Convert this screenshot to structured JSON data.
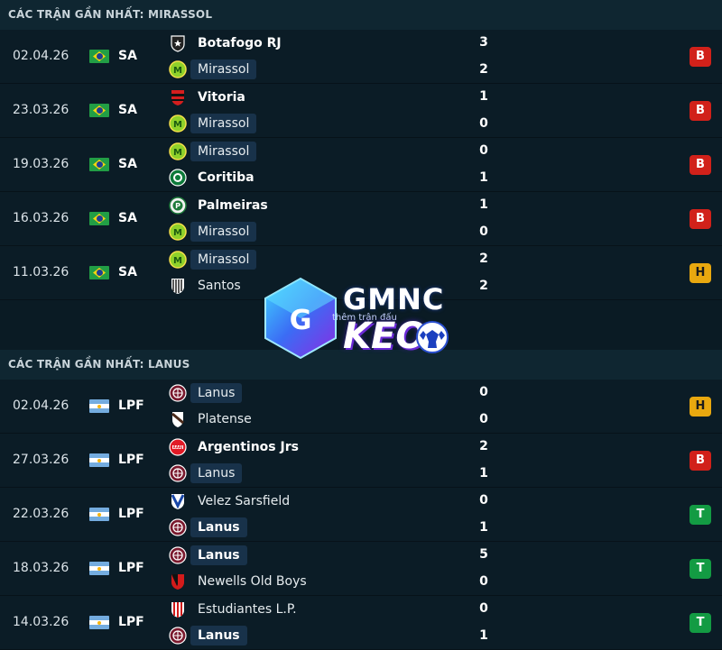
{
  "sections": [
    {
      "title": "CÁC TRẬN GẦN NHẤT: MIRASSOL",
      "matches": [
        {
          "date": "02.04.26",
          "flag": "brazil",
          "league": "SA",
          "home": "Botafogo RJ",
          "away": "Mirassol",
          "home_score": "3",
          "away_score": "2",
          "result": "B"
        },
        {
          "date": "23.03.26",
          "flag": "brazil",
          "league": "SA",
          "home": "Vitoria",
          "away": "Mirassol",
          "home_score": "1",
          "away_score": "0",
          "result": "B"
        },
        {
          "date": "19.03.26",
          "flag": "brazil",
          "league": "SA",
          "home": "Mirassol",
          "away": "Coritiba",
          "home_score": "0",
          "away_score": "1",
          "result": "B"
        },
        {
          "date": "16.03.26",
          "flag": "brazil",
          "league": "SA",
          "home": "Palmeiras",
          "away": "Mirassol",
          "home_score": "1",
          "away_score": "0",
          "result": "B"
        },
        {
          "date": "11.03.26",
          "flag": "brazil",
          "league": "SA",
          "home": "Mirassol",
          "away": "Santos",
          "home_score": "2",
          "away_score": "2",
          "result": "H"
        }
      ]
    },
    {
      "title": "CÁC TRẬN GẦN NHẤT: LANUS",
      "matches": [
        {
          "date": "02.04.26",
          "flag": "argentina",
          "league": "LPF",
          "home": "Lanus",
          "away": "Platense",
          "home_score": "0",
          "away_score": "0",
          "result": "H"
        },
        {
          "date": "27.03.26",
          "flag": "argentina",
          "league": "LPF",
          "home": "Argentinos Jrs",
          "away": "Lanus",
          "home_score": "2",
          "away_score": "1",
          "result": "B"
        },
        {
          "date": "22.03.26",
          "flag": "argentina",
          "league": "LPF",
          "home": "Velez Sarsfield",
          "away": "Lanus",
          "home_score": "0",
          "away_score": "1",
          "result": "T"
        },
        {
          "date": "18.03.26",
          "flag": "argentina",
          "league": "LPF",
          "home": "Lanus",
          "away": "Newells Old Boys",
          "home_score": "5",
          "away_score": "0",
          "result": "T"
        },
        {
          "date": "14.03.26",
          "flag": "argentina",
          "league": "LPF",
          "home": "Estudiantes L.P.",
          "away": "Lanus",
          "home_score": "0",
          "away_score": "1",
          "result": "T"
        }
      ]
    }
  ],
  "watermark": {
    "line1": "GMNC",
    "line2": "KEO",
    "tagline": "thêm trận đấu"
  },
  "colors": {
    "loss": "#d1211a",
    "draw": "#e9a80f",
    "win": "#139b43",
    "highlight": "#18324a"
  },
  "crest_icons": {
    "Botafogo RJ": "botafogo-star-crest-icon",
    "Mirassol": "mirassol-green-crest-icon",
    "Vitoria": "vitoria-red-black-crest-icon",
    "Coritiba": "coritiba-green-crest-icon",
    "Palmeiras": "palmeiras-green-crest-icon",
    "Santos": "santos-striped-crest-icon",
    "Lanus": "lanus-maroon-crest-icon",
    "Platense": "platense-crest-icon",
    "Argentinos Jrs": "argentinos-red-blue-crest-icon",
    "Velez Sarsfield": "velez-v-crest-icon",
    "Newells Old Boys": "newells-red-black-crest-icon",
    "Estudiantes L.P.": "estudiantes-striped-crest-icon"
  }
}
